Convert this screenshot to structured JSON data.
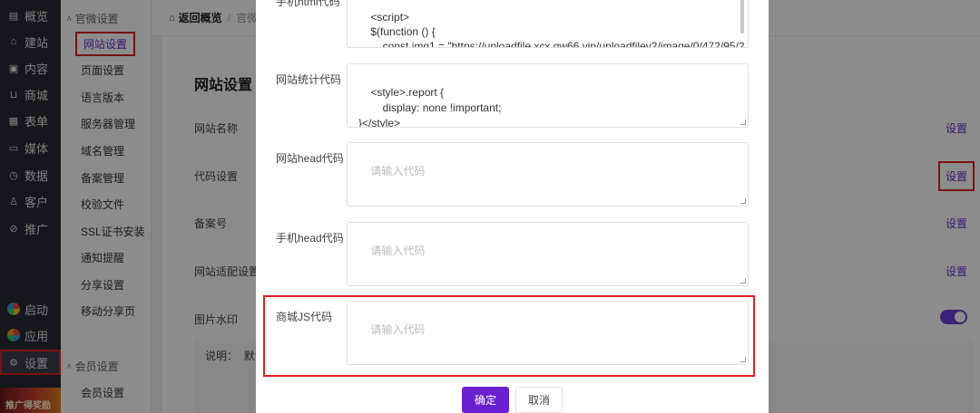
{
  "nav": {
    "items": [
      {
        "icon": "calendar-icon",
        "glyph": "▤",
        "label": "概览"
      },
      {
        "icon": "home-icon",
        "glyph": "⌂",
        "label": "建站"
      },
      {
        "icon": "document-icon",
        "glyph": "▣",
        "label": "内容"
      },
      {
        "icon": "cart-icon",
        "glyph": "⊔",
        "label": "商城"
      },
      {
        "icon": "form-icon",
        "glyph": "▦",
        "label": "表单"
      },
      {
        "icon": "video-icon",
        "glyph": "▭",
        "label": "媒体"
      },
      {
        "icon": "clock-icon",
        "glyph": "◷",
        "label": "数据"
      },
      {
        "icon": "user-icon",
        "glyph": "♙",
        "label": "客户"
      },
      {
        "icon": "link-icon",
        "glyph": "⊘",
        "label": "推广"
      }
    ],
    "bottom": [
      {
        "icon": "launch-icon",
        "label": "启动"
      },
      {
        "icon": "apps-icon",
        "label": "应用"
      },
      {
        "icon": "gear-icon",
        "glyph": "⚙",
        "label": "设置"
      }
    ],
    "promo_text": "推广得奖励"
  },
  "submenu": {
    "group1": "官微设置",
    "items": [
      "网站设置",
      "页面设置",
      "语言版本",
      "服务器管理",
      "域名管理",
      "备案管理",
      "校验文件",
      "SSL证书安装",
      "通知提醒",
      "分享设置",
      "移动分享页"
    ],
    "group2": "会员设置",
    "items2": [
      "会员设置"
    ]
  },
  "topbar": {
    "back": "返回概览",
    "separator": "/",
    "crumb": "官微"
  },
  "card": {
    "title": "网站设置",
    "rows": [
      "网站名称",
      "代码设置",
      "备案号",
      "网站适配设置",
      "图片水印"
    ],
    "link": "设置",
    "note_label": "说明：",
    "note_text": "默认"
  },
  "modal": {
    "fields": [
      {
        "label": "手机html代码",
        "value": "<script>\n    $(function () {\n        const img1 = \"https://uploadfile.xcx.gw66.vip/uploadfilev2/image/0/472/95/2"
      },
      {
        "label": "网站统计代码",
        "value": "<style>.report {\n        display: none !important;\n}</style>"
      },
      {
        "label": "网站head代码",
        "placeholder": "请输入代码"
      },
      {
        "label": "手机head代码",
        "placeholder": "请输入代码"
      },
      {
        "label": "商城JS代码",
        "placeholder": "请输入代码"
      }
    ],
    "ok_label": "确定",
    "cancel_label": "取消"
  },
  "colors": {
    "accent": "#6a1fd1",
    "highlight": "#e02020",
    "nav_bg": "#262a33"
  }
}
